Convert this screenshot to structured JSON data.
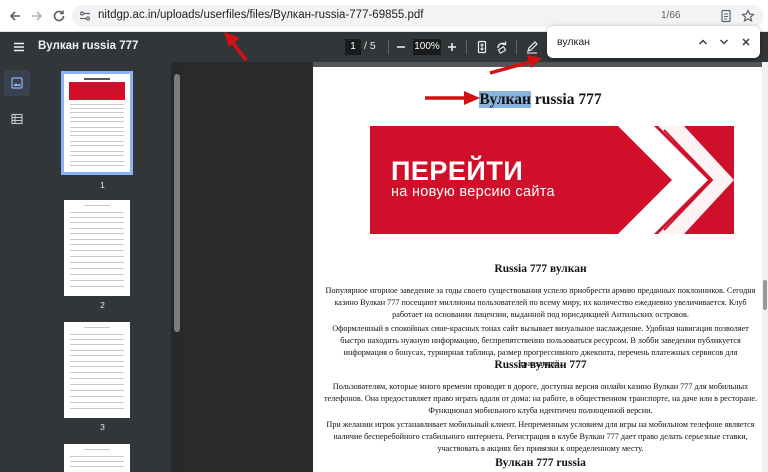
{
  "browser": {
    "url_host": "nitdgp.ac.in",
    "url_path": "/uploads/userfiles/files/Вулкан-russia-777-69855.pdf"
  },
  "toolbar": {
    "title": "Вулкан russia 777",
    "current_page": "1",
    "total_pages": "/ 5",
    "zoom": "100%"
  },
  "find": {
    "query": "вулкан",
    "count": "1/66"
  },
  "thumbnails": [
    {
      "number": "1",
      "selected": true
    },
    {
      "number": "2",
      "selected": false
    },
    {
      "number": "3",
      "selected": false
    }
  ],
  "page": {
    "title_highlight": "Вулкан",
    "title_rest": " russia 777",
    "banner_main": "ПЕРЕЙТИ",
    "banner_sub": "на новую версию сайта",
    "banner_color": "#d0102a",
    "heading1": "Russia 777 вулкан",
    "para1": "Популярное игорное заведение за годы своего существования успело приобрести армию преданных поклонников. Сегодня казино Вулкан 777 посещают миллионы пользователей по всему миру, их количество ежедневно увеличивается. Клуб работает на основании лицензии, выданной под юрисдикцией Антильских островов.",
    "para2": "Оформленный в спокойных сине-красных тонах сайт вызывает визуальное наслаждение. Удобная навигация позволяет быстро находить нужную информацию, беспрепятственно пользоваться ресурсом. В лобби заведения публикуется информация о бонусах, турнирная таблица, размер прогрессивного джекпота, перечень платежных сервисов для транзакций.",
    "heading2": "Russia вулкан 777",
    "para3": "Пользователям, которые много времени проводят в дороге, доступна версия онлайн казино Вулкан 777 для мобильных телефонов. Она предоставляет право играть вдали от дома: на работе, в общественном транспорте, на даче или в ресторане. Функционал мобильного клуба идентичен полноценной версии.",
    "para4": "При желании игрок устанавливает мобильный клиент. Непременным условием для игры на мобильном телефоне является наличие бесперебойного стабильного интернета. Регистрация в клубе Вулкан 777 дает право делать серьезные ставки, участвовать в акциях без привязки к определенному месту.",
    "heading3": "Вулкан 777 russia"
  },
  "colors": {
    "annotation_arrow": "#d41111",
    "highlight": "#8ab4dd",
    "toolbar_bg": "#323639"
  }
}
